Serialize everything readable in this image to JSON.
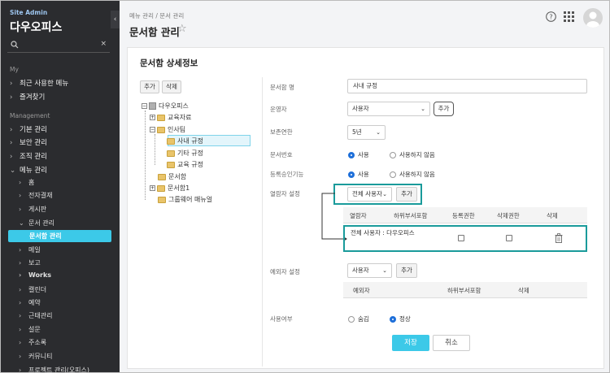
{
  "sidebar": {
    "site_label": "Site Admin",
    "title": "다우오피스",
    "search_placeholder": "",
    "search_clear": "×",
    "collapse": "‹",
    "section_my": "My",
    "my_items": [
      "최근 사용한 메뉴",
      "즐겨찾기"
    ],
    "section_management": "Management",
    "mgmt_items": [
      "기본 관리",
      "보안 관리",
      "조직 관리",
      "메뉴 관리"
    ],
    "menu_children": [
      "홈",
      "전자결재",
      "게시판",
      "문서 관리"
    ],
    "doc_active": "문서함 관리",
    "more_items": [
      "메일",
      "보고",
      "Works",
      "캘린더",
      "예약",
      "근태관리",
      "설문",
      "주소록",
      "커뮤니티"
    ],
    "cut_item": "프로젝트 관리(오피스)"
  },
  "header": {
    "breadcrumb": "메뉴 관리 / 문서 관리",
    "title": "문서함 관리",
    "star_icon": "☆",
    "help_icon": "?"
  },
  "panel": {
    "title": "문서함 상세정보",
    "tree_buttons": {
      "add": "추가",
      "delete": "삭제"
    },
    "tree": {
      "root": "다우오피스",
      "n1": "교육자료",
      "n2": "인사팀",
      "n2a": "사내 규정",
      "n2b": "기타 규정",
      "n2c": "교육 규정",
      "n3": "문서함",
      "n4": "문서함1",
      "n5": "그룹웨어 매뉴얼"
    },
    "form": {
      "name_label": "문서함 명",
      "name_value": "사내 규정",
      "operator_label": "운영자",
      "operator_value": "사용자",
      "add_label": "추가",
      "retention_label": "보존연한",
      "retention_value": "5년",
      "docno_label": "문서번호",
      "use": "사용",
      "not_use": "사용하지 않음",
      "approval_label": "등록승인기능",
      "viewer_label": "열람자 설정",
      "viewer_select": "전체 사용자",
      "viewer_cols": [
        "열람자",
        "하위부서포함",
        "등록권한",
        "삭제권한",
        "삭제"
      ],
      "viewer_row": "전체 사용자 : 다우오피스",
      "except_label": "예외자 설정",
      "except_select": "사용자",
      "except_cols": [
        "예외자",
        "하위부서포함",
        "삭제"
      ],
      "status_label": "사용여부",
      "hidden": "숨김",
      "normal": "정상",
      "save": "저장",
      "cancel": "취소"
    }
  }
}
